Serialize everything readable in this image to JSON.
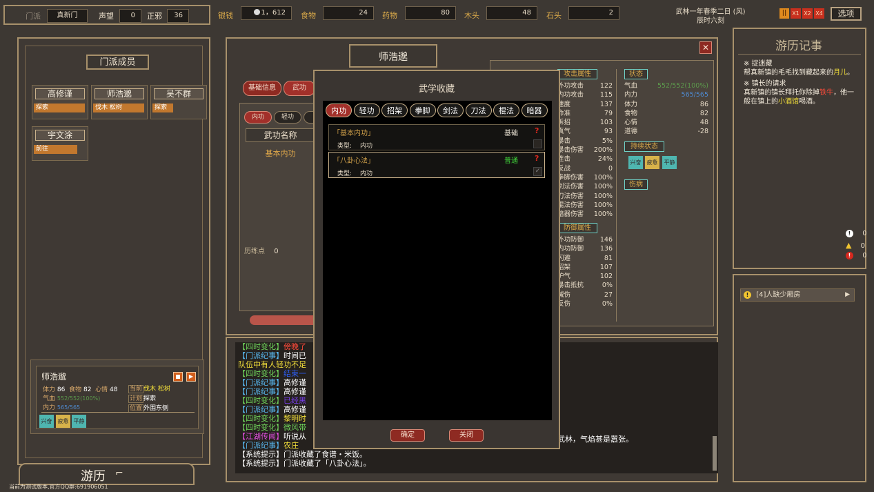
{
  "topbar": {
    "sect_label": "门派",
    "sect_value": "真新门",
    "reputation_label": "声望",
    "reputation_value": "0",
    "morality_label": "正邪",
    "morality_value": "36",
    "silver_label": "银钱",
    "silver_value": "1，612",
    "food_label": "食物",
    "food_value": "24",
    "medicine_label": "药物",
    "medicine_value": "80",
    "wood_label": "木头",
    "wood_value": "48",
    "stone_label": "石头",
    "stone_value": "2",
    "date_line1": "武林一年春季二日 (风)",
    "date_line2": "辰时六刻",
    "speed_pause": "||",
    "speed_x1": "X1",
    "speed_x2": "X2",
    "speed_x4": "X4",
    "options_label": "选项"
  },
  "left_panel": {
    "title": "门派成员",
    "members": [
      {
        "name": "高修谨",
        "task": "探索"
      },
      {
        "name": "师浩邈",
        "task": "伐木 松树"
      },
      {
        "name": "吴不群",
        "task": "探索"
      },
      {
        "name": "宇文涂",
        "task": "前往"
      }
    ],
    "detail": {
      "name": "师浩邈",
      "hp_label": "体力",
      "hp_value": "86",
      "food_label": "食物",
      "food_value": "82",
      "mood_label": "心情",
      "mood_value": "48",
      "qi_label": "气血",
      "qi_value": "552/552(100%)",
      "neili_label": "内力",
      "neili_value": "565/565",
      "current_label": "当前",
      "current_value": "伐木 松树",
      "plan_label": "计划",
      "plan_value": "探索",
      "position_label": "位置",
      "position_value": "外围东侧",
      "statuses": [
        "兴奋",
        "疲惫",
        "平静"
      ]
    },
    "travel_button": "游历"
  },
  "character_panel": {
    "title": "师浩邈",
    "tabs": [
      "基础信息",
      "武功"
    ],
    "subtabs": [
      "内功",
      "轻功",
      ""
    ],
    "kungfu_header": "武功名称",
    "kungfu_first": "基本内功",
    "training_label": "历练点",
    "training_value": "0",
    "attack_title": "攻击属性",
    "attack_stats": [
      {
        "label": "外功攻击",
        "value": "122"
      },
      {
        "label": "内功攻击",
        "value": "115"
      },
      {
        "label": "速度",
        "value": "137"
      },
      {
        "label": "命准",
        "value": "79"
      },
      {
        "label": "拆招",
        "value": "103"
      },
      {
        "label": "真气",
        "value": "93"
      },
      {
        "label": "暴击",
        "value": "5%"
      },
      {
        "label": "暴击伤害",
        "value": "200%"
      },
      {
        "label": "连击",
        "value": "24%"
      },
      {
        "label": "反战",
        "value": "0"
      },
      {
        "label": "拳脚伤害",
        "value": "100%"
      },
      {
        "label": "剑法伤害",
        "value": "100%"
      },
      {
        "label": "刀法伤害",
        "value": "100%"
      },
      {
        "label": "棍法伤害",
        "value": "100%"
      },
      {
        "label": "暗器伤害",
        "value": "100%"
      }
    ],
    "defense_title": "防御属性",
    "defense_stats": [
      {
        "label": "外功防御",
        "value": "146"
      },
      {
        "label": "内功防御",
        "value": "136"
      },
      {
        "label": "闪避",
        "value": "81"
      },
      {
        "label": "招架",
        "value": "107"
      },
      {
        "label": "护气",
        "value": "102"
      },
      {
        "label": "暴击抵抗",
        "value": "0%"
      },
      {
        "label": "减伤",
        "value": "27"
      },
      {
        "label": "反伤",
        "value": "0%"
      }
    ],
    "state_title": "状态",
    "state_stats": [
      {
        "label": "气血",
        "value": "552/552(100%)"
      },
      {
        "label": "内力",
        "value": "565/565"
      },
      {
        "label": "体力",
        "value": "86"
      },
      {
        "label": "食物",
        "value": "82"
      },
      {
        "label": "心情",
        "value": "48"
      },
      {
        "label": "道德",
        "value": "-28"
      }
    ],
    "ongoing_title": "持续状态",
    "ongoing": [
      "兴奋",
      "疲惫",
      "平静"
    ],
    "injury_title": "伤病"
  },
  "modal": {
    "title": "武学收藏",
    "tabs": [
      "内功",
      "轻功",
      "招架",
      "拳脚",
      "剑法",
      "刀法",
      "棍法",
      "暗器"
    ],
    "items": [
      {
        "name": "「基本内功」",
        "grade": "基础",
        "type_label": "类型:",
        "type_value": "内功",
        "help": "?"
      },
      {
        "name": "「八卦心法」",
        "grade": "普通",
        "type_label": "类型:",
        "type_value": "内功",
        "help": "?"
      }
    ],
    "confirm": "确定",
    "close": "关闭"
  },
  "log": {
    "lines": [
      {
        "tag": "【四时变化】",
        "text": "傍晚了",
        "tag_color": "#6fd25a",
        "text_color": "#ff4b3a"
      },
      {
        "tag": "【门派纪事】",
        "text": "时间已",
        "tag_color": "#58b8f0",
        "text_color": "#ffffff"
      },
      {
        "tag": "",
        "text": "队伍中有人轻功不足",
        "tag_color": "#f6e23a",
        "text_color": "#f6e23a"
      },
      {
        "tag": "【四时变化】",
        "text": "结束一",
        "tag_color": "#6fd25a",
        "text_color": "#2d5cf0"
      },
      {
        "tag": "【门派纪事】",
        "text": "高修谨",
        "tag_color": "#58b8f0",
        "text_color": "#ffffff"
      },
      {
        "tag": "【门派纪事】",
        "text": "高修谨",
        "tag_color": "#58b8f0",
        "text_color": "#ffffff"
      },
      {
        "tag": "【四时变化】",
        "text": "已经黑",
        "tag_color": "#6fd25a",
        "text_color": "#7a3ff0"
      },
      {
        "tag": "【门派纪事】",
        "text": "高修谨",
        "tag_color": "#58b8f0",
        "text_color": "#ffffff"
      },
      {
        "tag": "【四时变化】",
        "text": "黎明时",
        "tag_color": "#6fd25a",
        "text_color": "#f6e23a"
      },
      {
        "tag": "【四时变化】",
        "text": "微风带",
        "tag_color": "#6fd25a",
        "text_color": "#6fd25a"
      },
      {
        "tag": "【江湖传闻】",
        "text": "听说从",
        "tag_color": "#e24fe0",
        "text_color": "#ffffff"
      },
      {
        "tag": "【门派纪事】",
        "text": "农庄",
        "tag_color": "#58b8f0",
        "text_color": "#f6e23a"
      },
      {
        "tag": "【系统提示】",
        "text": "门派收藏了食谱・米饭。",
        "tag_color": "#ffffff",
        "text_color": "#ffffff"
      },
      {
        "tag": "【系统提示】",
        "text": "门派收藏了「八卦心法」。",
        "tag_color": "#ffffff",
        "text_color": "#ffffff"
      }
    ],
    "overflow_text": "武林，气焰甚是嚣张。"
  },
  "right_panel": {
    "title": "游历记事",
    "events": [
      {
        "heading": "※ 捉迷藏",
        "body": "帮真新镇的毛毛找到藏起来的",
        "highlight": "月儿",
        "tail": "。"
      },
      {
        "heading": "※ 镇长的请求",
        "body": "真新镇的镇长拜托你除掉",
        "highlight": "铁牛",
        "tail": "，他一般在镇上的",
        "highlight2": "小酒馆",
        "tail2": "喝酒。"
      }
    ],
    "alerts": [
      "0",
      "0",
      "0"
    ],
    "notice": "[4]人缺少厢房"
  },
  "footer": "当前为测试版本,官方QQ群:691906051",
  "colors": {
    "accent_gold": "#d9a94a",
    "panel_border": "#a8916b",
    "red_tab": "#a2302a",
    "orange_tag": "#c2782e"
  }
}
